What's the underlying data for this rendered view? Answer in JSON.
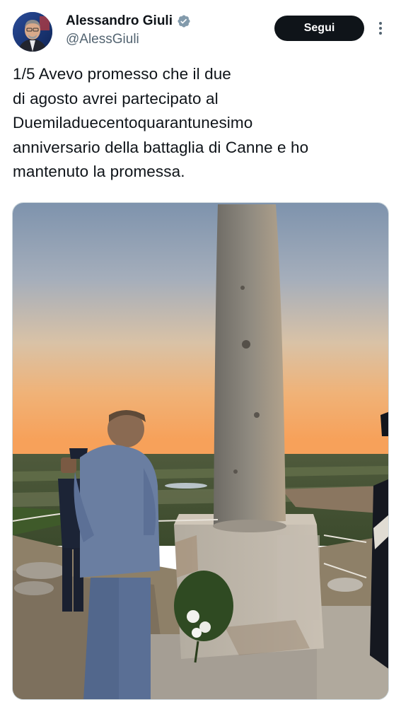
{
  "author": {
    "display_name": "Alessandro Giuli",
    "handle": "@AlessGiuli",
    "verified_icon": "verified-badge-icon",
    "avatar_icon": "avatar"
  },
  "actions": {
    "follow_label": "Segui",
    "more_icon": "more-options-icon"
  },
  "tweet": {
    "text_lines": [
      "1/5 Avevo promesso che il due",
      "di agosto avrei partecipato al",
      "Duemiladuecentoquarantunesimo",
      "anniversario della battaglia di Canne e ho",
      "mantenuto la promessa."
    ]
  },
  "media": {
    "type": "photo"
  },
  "colors": {
    "follow_bg": "#0f1419",
    "verified": "#829aab",
    "handle": "#536471"
  }
}
